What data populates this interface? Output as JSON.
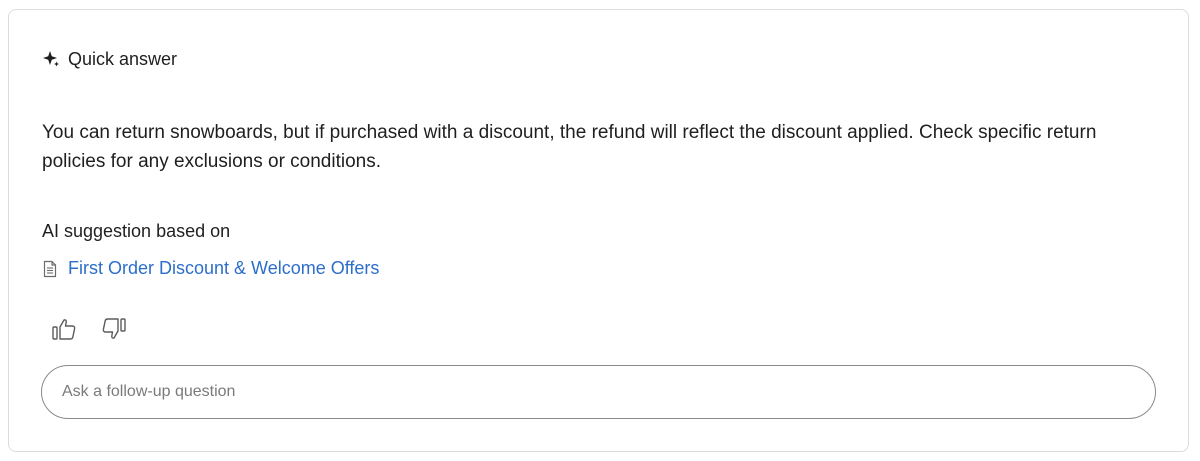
{
  "header": {
    "icon": "sparkle-icon",
    "title": "Quick answer"
  },
  "answer": {
    "text": "You can return snowboards, but if purchased with a discount, the refund will reflect the discount applied. Check specific return policies for any exclusions or conditions."
  },
  "sources": {
    "label": "AI suggestion based on",
    "items": [
      {
        "icon": "document-icon",
        "title": "First Order Discount & Welcome Offers"
      }
    ]
  },
  "feedback": {
    "icons": [
      "thumbs-up-icon",
      "thumbs-down-icon"
    ]
  },
  "followup": {
    "placeholder": "Ask a follow-up question",
    "value": ""
  },
  "colors": {
    "link": "#2c6ecb",
    "text": "#1f1f1f",
    "border": "#dcdcdc",
    "icon": "#5c5c5c"
  }
}
